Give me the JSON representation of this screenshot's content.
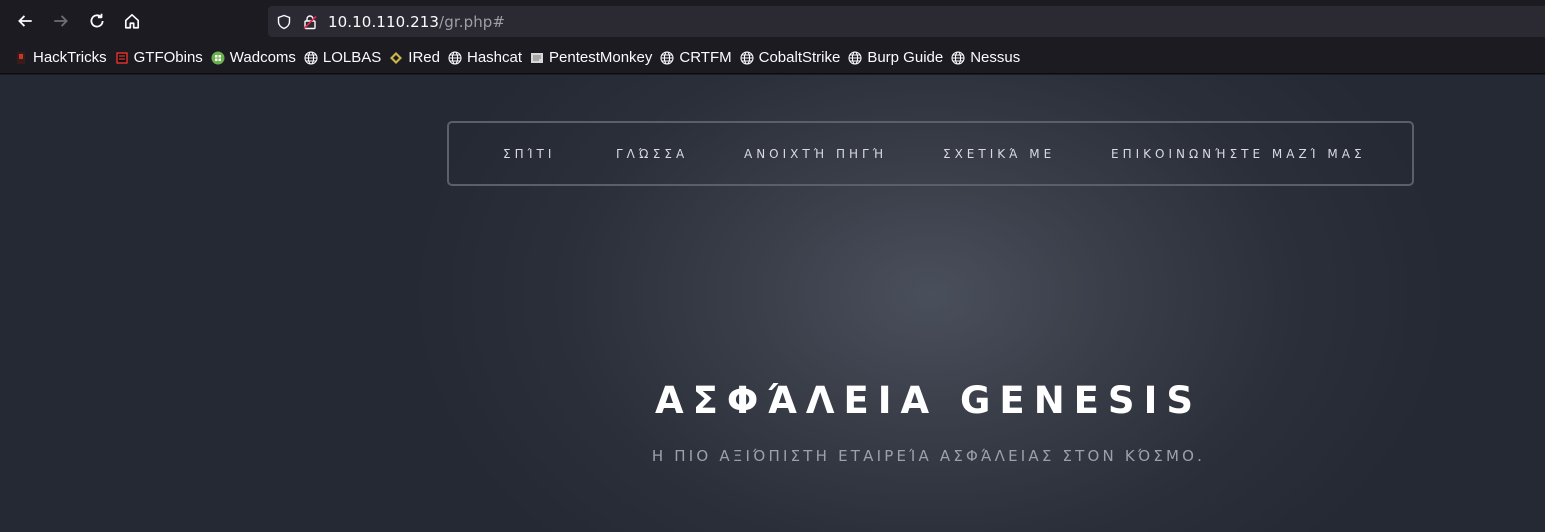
{
  "browser": {
    "url_host": "10.10.110.213",
    "url_path": "/gr.php#",
    "bookmarks": [
      {
        "label": "HackTricks",
        "icon": "hacktricks-icon"
      },
      {
        "label": "GTFObins",
        "icon": "gtfobins-icon"
      },
      {
        "label": "Wadcoms",
        "icon": "wadcoms-icon"
      },
      {
        "label": "LOLBAS",
        "icon": "globe-icon"
      },
      {
        "label": "IRed",
        "icon": "ired-icon"
      },
      {
        "label": "Hashcat",
        "icon": "globe-icon"
      },
      {
        "label": "PentestMonkey",
        "icon": "pentestmonkey-icon"
      },
      {
        "label": "CRTFM",
        "icon": "globe-icon"
      },
      {
        "label": "CobaltStrike",
        "icon": "globe-icon"
      },
      {
        "label": "Burp Guide",
        "icon": "globe-icon"
      },
      {
        "label": "Nessus",
        "icon": "globe-icon"
      }
    ]
  },
  "nav": {
    "items": [
      {
        "label": "ΣΠΊΤΙ"
      },
      {
        "label": "ΓΛΏΣΣΑ"
      },
      {
        "label": "ΑΝΟΙΧΤΉ ΠΗΓΉ"
      },
      {
        "label": "ΣΧΕΤΙΚΆ ΜΕ"
      },
      {
        "label": "ΕΠΙΚΟΙΝΩΝΉΣΤΕ ΜΑΖΊ ΜΑΣ"
      }
    ]
  },
  "hero": {
    "title": "ΑΣΦΆΛΕΙΑ GENESIS",
    "subtitle": "Η ΠΙΟ ΑΞΙΌΠΙΣΤΗ ΕΤΑΙΡΕΊΑ ΑΣΦΆΛΕΙΑΣ ΣΤΟΝ ΚΌΣΜΟ."
  },
  "colors": {
    "chrome_bg": "#1c1b22",
    "urlbar_bg": "#2b2a33",
    "page_bg": "#2b2f39"
  }
}
